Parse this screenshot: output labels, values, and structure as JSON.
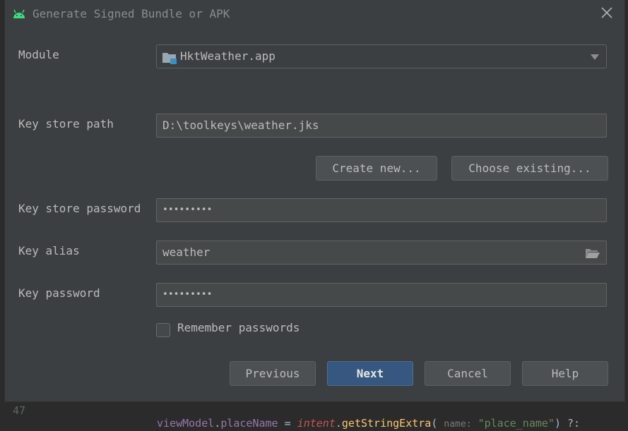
{
  "dialog": {
    "title": "Generate Signed Bundle or APK"
  },
  "form": {
    "module": {
      "label": "Module",
      "value": "HktWeather.app"
    },
    "key_store_path": {
      "label": "Key store path",
      "value": "D:\\toolkeys\\weather.jks"
    },
    "create_new_label": "Create new...",
    "choose_existing_label": "Choose existing...",
    "key_store_password": {
      "label": "Key store password",
      "value": "•••••••••"
    },
    "key_alias": {
      "label": "Key alias",
      "value": "weather"
    },
    "key_password": {
      "label": "Key password",
      "value": "•••••••••"
    },
    "remember_passwords": {
      "label": "Remember passwords",
      "checked": false
    }
  },
  "buttons": {
    "previous": "Previous",
    "next": "Next",
    "cancel": "Cancel",
    "help": "Help"
  },
  "background_code": {
    "line_number": "47",
    "object": "viewModel",
    "property": "placeName",
    "op": " = ",
    "intent": "intent",
    "method": "getStringExtra",
    "hint": "name:",
    "arg": "\"place_name\"",
    "tail": ") ?:"
  },
  "colors": {
    "dialog_bg": "#3c3f41",
    "field_bg": "#45494a",
    "primary_button": "#365880",
    "android_green": "#3ddc84"
  }
}
